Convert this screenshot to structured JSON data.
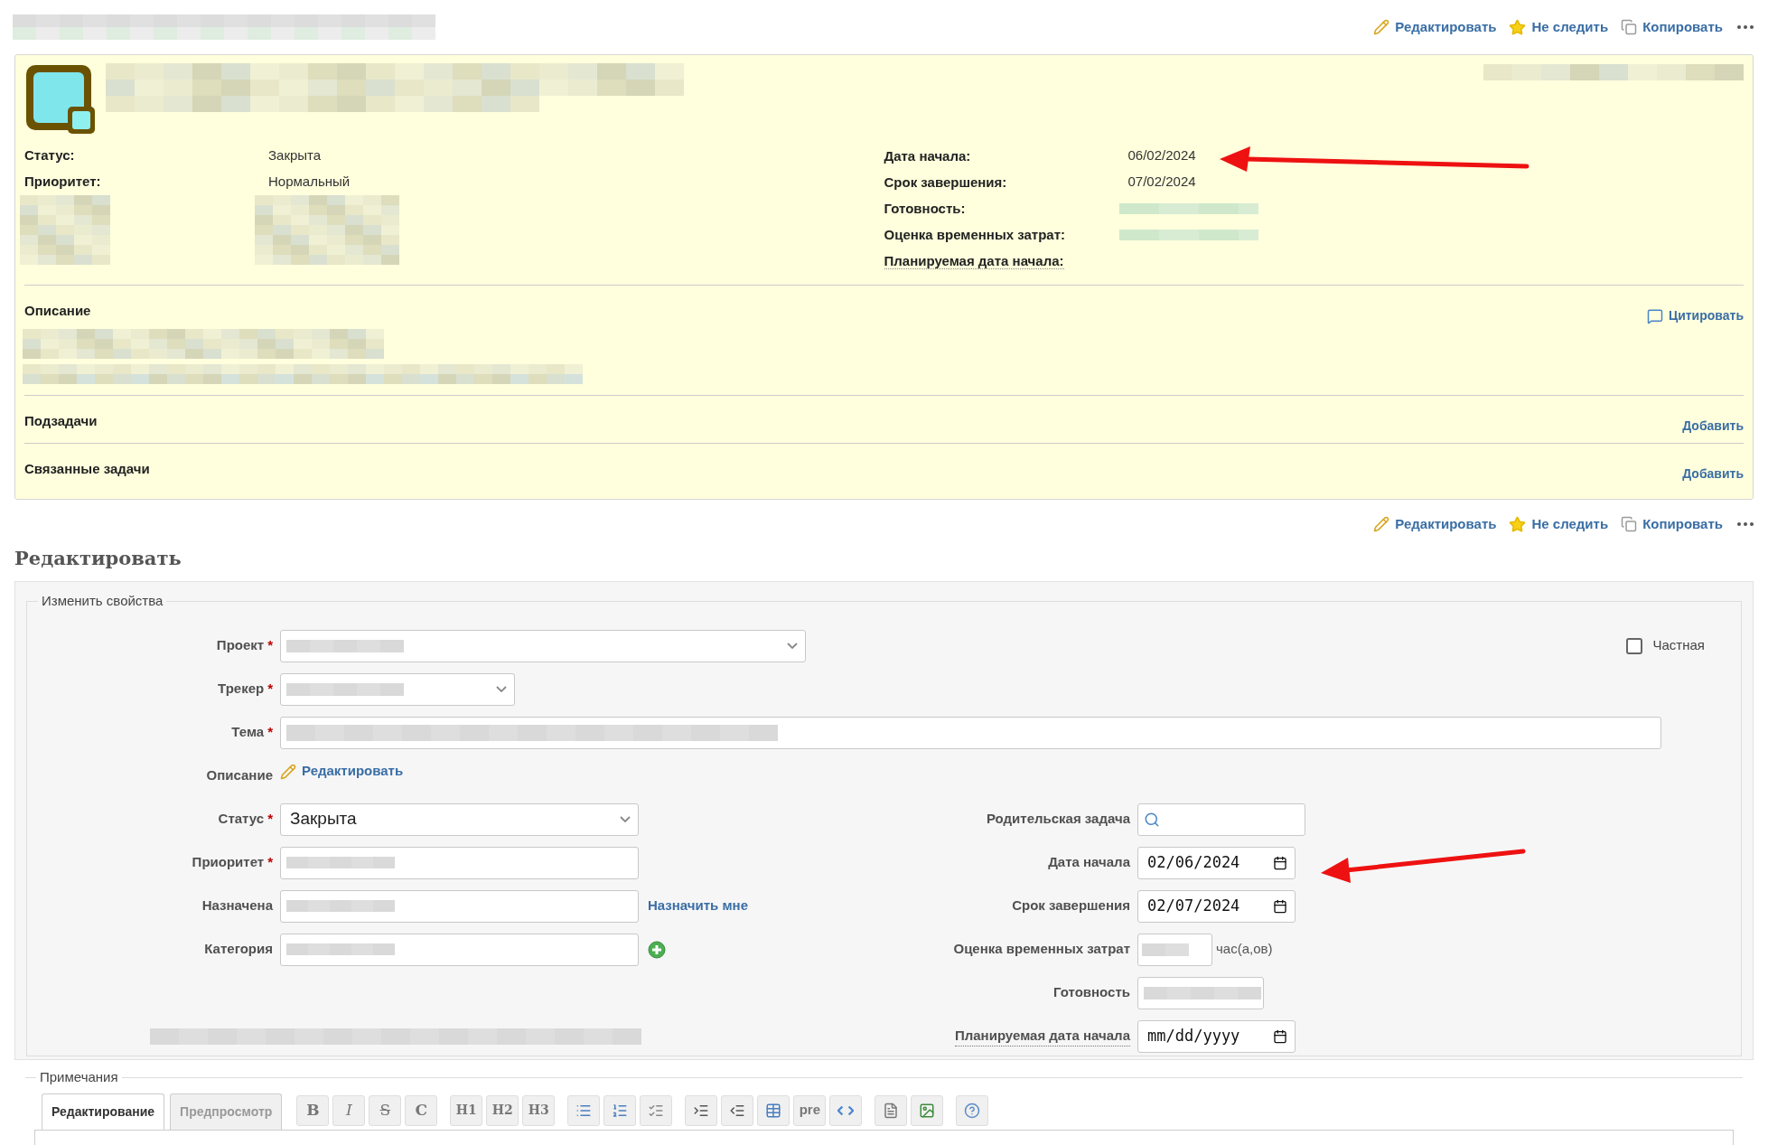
{
  "header_actions": [
    {
      "kind": "edit",
      "label": "Редактировать"
    },
    {
      "kind": "watch",
      "label": "Не следить"
    },
    {
      "kind": "copy",
      "label": "Копировать"
    },
    {
      "kind": "more"
    }
  ],
  "issue": {
    "attributes_left": [
      {
        "label": "Статус:",
        "value": "Закрыта"
      },
      {
        "label": "Приоритет:",
        "value": "Нормальный"
      }
    ],
    "attributes_right": [
      {
        "label": "Дата начала:",
        "value": "06/02/2024"
      },
      {
        "label": "Срок завершения:",
        "value": "07/02/2024"
      },
      {
        "label": "Готовность:",
        "redacted": true
      },
      {
        "label": "Оценка временных затрат:",
        "redacted": true
      },
      {
        "label": "Планируемая дата начала:",
        "hint": true
      }
    ],
    "description": {
      "title": "Описание",
      "quote": "Цитировать"
    },
    "sections": [
      {
        "title": "Подзадачи",
        "action": "Добавить"
      },
      {
        "title": "Связанные задачи",
        "action": "Добавить"
      }
    ]
  },
  "footer_actions": [
    {
      "kind": "edit",
      "label": "Редактировать"
    },
    {
      "kind": "watch",
      "label": "Не следить"
    },
    {
      "kind": "copy",
      "label": "Копировать"
    },
    {
      "kind": "more"
    }
  ],
  "edit": {
    "title": "Редактировать",
    "legend": "Изменить свойства",
    "private": {
      "label": "Частная",
      "checked": false
    },
    "top_fields": [
      {
        "kind": "select",
        "label": "Проект",
        "required_mark": "*",
        "redacted": true
      },
      {
        "kind": "select",
        "label": "Трекер",
        "required_mark": "*",
        "redacted": true
      },
      {
        "kind": "text",
        "label": "Тема",
        "required_mark": "*",
        "redacted": true
      },
      {
        "kind": "link",
        "label": "Описание",
        "link": "Редактировать"
      }
    ],
    "left_fields": [
      {
        "kind": "select",
        "label": "Статус",
        "required_mark": "*",
        "value": "Закрыта"
      },
      {
        "kind": "combo",
        "label": "Приоритет",
        "required_mark": "*",
        "redacted": true
      },
      {
        "kind": "combo",
        "label": "Назначена",
        "redacted": true,
        "link": "Назначить мне"
      },
      {
        "kind": "combo",
        "label": "Категория",
        "redacted": true,
        "add": true
      },
      {
        "kind": "spacer"
      },
      {
        "kind": "redacted"
      }
    ],
    "right_fields": [
      {
        "kind": "search",
        "label": "Родительская задача"
      },
      {
        "kind": "date",
        "label": "Дата начала",
        "value": "02/06/2024"
      },
      {
        "kind": "date",
        "label": "Срок завершения",
        "value": "02/07/2024"
      },
      {
        "kind": "number",
        "label": "Оценка временных затрат",
        "redacted": true,
        "unit": "час(а,ов)"
      },
      {
        "kind": "select",
        "label": "Готовность",
        "redacted": true
      },
      {
        "kind": "date",
        "label": "Планируемая дата начала",
        "placeholder": "mm/dd/yyyy",
        "hint": true
      }
    ]
  },
  "notes": {
    "legend": "Примечания",
    "tabs": [
      {
        "label": "Редактирование",
        "selected": true
      },
      {
        "label": "Предпросмотр",
        "selected": false
      }
    ],
    "toolbar": [
      [
        {
          "kind": "bold",
          "label": "B"
        },
        {
          "kind": "italic",
          "label": "I"
        },
        {
          "kind": "strike",
          "label": "S"
        },
        {
          "kind": "inline_code",
          "label": "C"
        }
      ],
      [
        {
          "kind": "heading",
          "label": "H1"
        },
        {
          "kind": "heading",
          "label": "H2"
        },
        {
          "kind": "heading",
          "label": "H3"
        }
      ],
      [
        {
          "kind": "ul"
        },
        {
          "kind": "ol"
        },
        {
          "kind": "checklist"
        }
      ],
      [
        {
          "kind": "indent"
        },
        {
          "kind": "outdent"
        },
        {
          "kind": "table"
        },
        {
          "kind": "pre",
          "label": "pre"
        },
        {
          "kind": "code"
        }
      ],
      [
        {
          "kind": "attach"
        },
        {
          "kind": "image"
        }
      ],
      [
        {
          "kind": "help"
        }
      ]
    ]
  }
}
